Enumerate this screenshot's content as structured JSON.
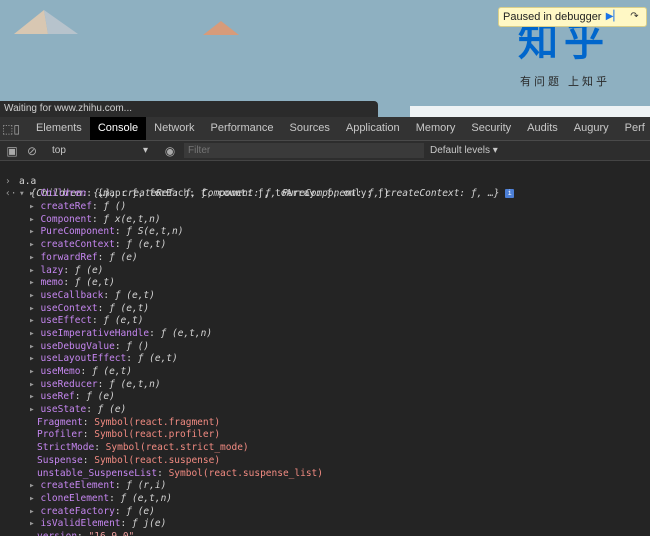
{
  "page": {
    "logo_text": "知乎",
    "logo_subtitle": "有问题 上知乎",
    "paused_label": "Paused in debugger",
    "status_text": "Waiting for www.zhihu.com..."
  },
  "devtools": {
    "tabs": [
      "Elements",
      "Console",
      "Network",
      "Performance",
      "Sources",
      "Application",
      "Memory",
      "Security",
      "Audits",
      "Augury",
      "Perf"
    ],
    "active_tab": "Console",
    "context": "top",
    "filter_placeholder": "Filter",
    "levels_label": "Default levels ▾"
  },
  "console": {
    "input": "a.a",
    "summary": "{Children: {…}, createRef: ƒ, Component: ƒ, PureComponent: ƒ, createContext: ƒ, …}",
    "entries": [
      {
        "expand": true,
        "key": "Children",
        "value": "{map: ƒ, forEach: ƒ, count: ƒ, toArray: ƒ, only: ƒ}",
        "kind": "obj"
      },
      {
        "expand": true,
        "key": "createRef",
        "value": "ƒ ()",
        "kind": "fn"
      },
      {
        "expand": true,
        "key": "Component",
        "value": "ƒ x(e,t,n)",
        "kind": "fn"
      },
      {
        "expand": true,
        "key": "PureComponent",
        "value": "ƒ S(e,t,n)",
        "kind": "fn"
      },
      {
        "expand": true,
        "key": "createContext",
        "value": "ƒ (e,t)",
        "kind": "fn"
      },
      {
        "expand": true,
        "key": "forwardRef",
        "value": "ƒ (e)",
        "kind": "fn"
      },
      {
        "expand": true,
        "key": "lazy",
        "value": "ƒ (e)",
        "kind": "fn"
      },
      {
        "expand": true,
        "key": "memo",
        "value": "ƒ (e,t)",
        "kind": "fn"
      },
      {
        "expand": true,
        "key": "useCallback",
        "value": "ƒ (e,t)",
        "kind": "fn"
      },
      {
        "expand": true,
        "key": "useContext",
        "value": "ƒ (e,t)",
        "kind": "fn"
      },
      {
        "expand": true,
        "key": "useEffect",
        "value": "ƒ (e,t)",
        "kind": "fn"
      },
      {
        "expand": true,
        "key": "useImperativeHandle",
        "value": "ƒ (e,t,n)",
        "kind": "fn"
      },
      {
        "expand": true,
        "key": "useDebugValue",
        "value": "ƒ ()",
        "kind": "fn"
      },
      {
        "expand": true,
        "key": "useLayoutEffect",
        "value": "ƒ (e,t)",
        "kind": "fn"
      },
      {
        "expand": true,
        "key": "useMemo",
        "value": "ƒ (e,t)",
        "kind": "fn"
      },
      {
        "expand": true,
        "key": "useReducer",
        "value": "ƒ (e,t,n)",
        "kind": "fn"
      },
      {
        "expand": true,
        "key": "useRef",
        "value": "ƒ (e)",
        "kind": "fn"
      },
      {
        "expand": true,
        "key": "useState",
        "value": "ƒ (e)",
        "kind": "fn"
      },
      {
        "expand": false,
        "key": "Fragment",
        "value": "Symbol(react.fragment)",
        "kind": "sym"
      },
      {
        "expand": false,
        "key": "Profiler",
        "value": "Symbol(react.profiler)",
        "kind": "sym"
      },
      {
        "expand": false,
        "key": "StrictMode",
        "value": "Symbol(react.strict_mode)",
        "kind": "sym"
      },
      {
        "expand": false,
        "key": "Suspense",
        "value": "Symbol(react.suspense)",
        "kind": "sym"
      },
      {
        "expand": false,
        "key": "unstable_SuspenseList",
        "value": "Symbol(react.suspense_list)",
        "kind": "sym"
      },
      {
        "expand": true,
        "key": "createElement",
        "value": "ƒ (r,i)",
        "kind": "fn"
      },
      {
        "expand": true,
        "key": "cloneElement",
        "value": "ƒ (e,t,n)",
        "kind": "fn"
      },
      {
        "expand": true,
        "key": "createFactory",
        "value": "ƒ (e)",
        "kind": "fn"
      },
      {
        "expand": true,
        "key": "isValidElement",
        "value": "ƒ j(e)",
        "kind": "fn"
      },
      {
        "expand": false,
        "key": "version",
        "value": "\"16.9.0\"",
        "kind": "str"
      }
    ]
  },
  "colors": {
    "page_bg": "#8eb0c1",
    "logo_blue": "#0066cc",
    "console_bg": "#242424",
    "key_purple": "#c586f0",
    "symbol_red": "#f28b82"
  }
}
